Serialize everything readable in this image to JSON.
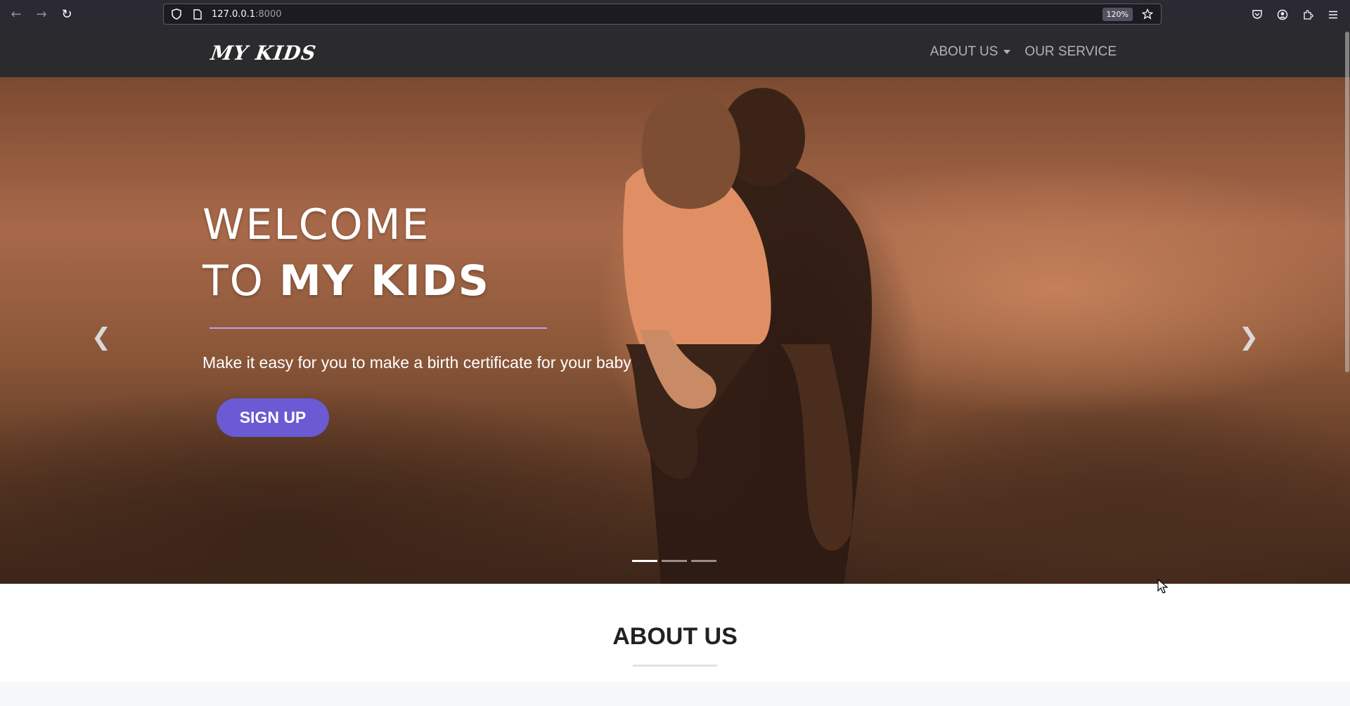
{
  "browser": {
    "url_host": "127.0.0.1",
    "url_port": ":8000",
    "zoom": "120%"
  },
  "nav": {
    "brand": "MY KIDS",
    "items": [
      {
        "label": "ABOUT US"
      },
      {
        "label": "OUR SERVICE"
      }
    ]
  },
  "hero": {
    "title_line1": "WELCOME",
    "title_line2_prefix": "TO ",
    "title_line2_strong": "MY KIDS",
    "subtitle": "Make it easy for you to make a birth certificate for your baby",
    "button_label": "SIGN UP",
    "slide_count": 3,
    "active_slide": 1
  },
  "about": {
    "title": "ABOUT US"
  },
  "colors": {
    "accent": "#6a5ad3",
    "divider": "#c5a0e6",
    "nav_bg": "#2b2b2d"
  }
}
